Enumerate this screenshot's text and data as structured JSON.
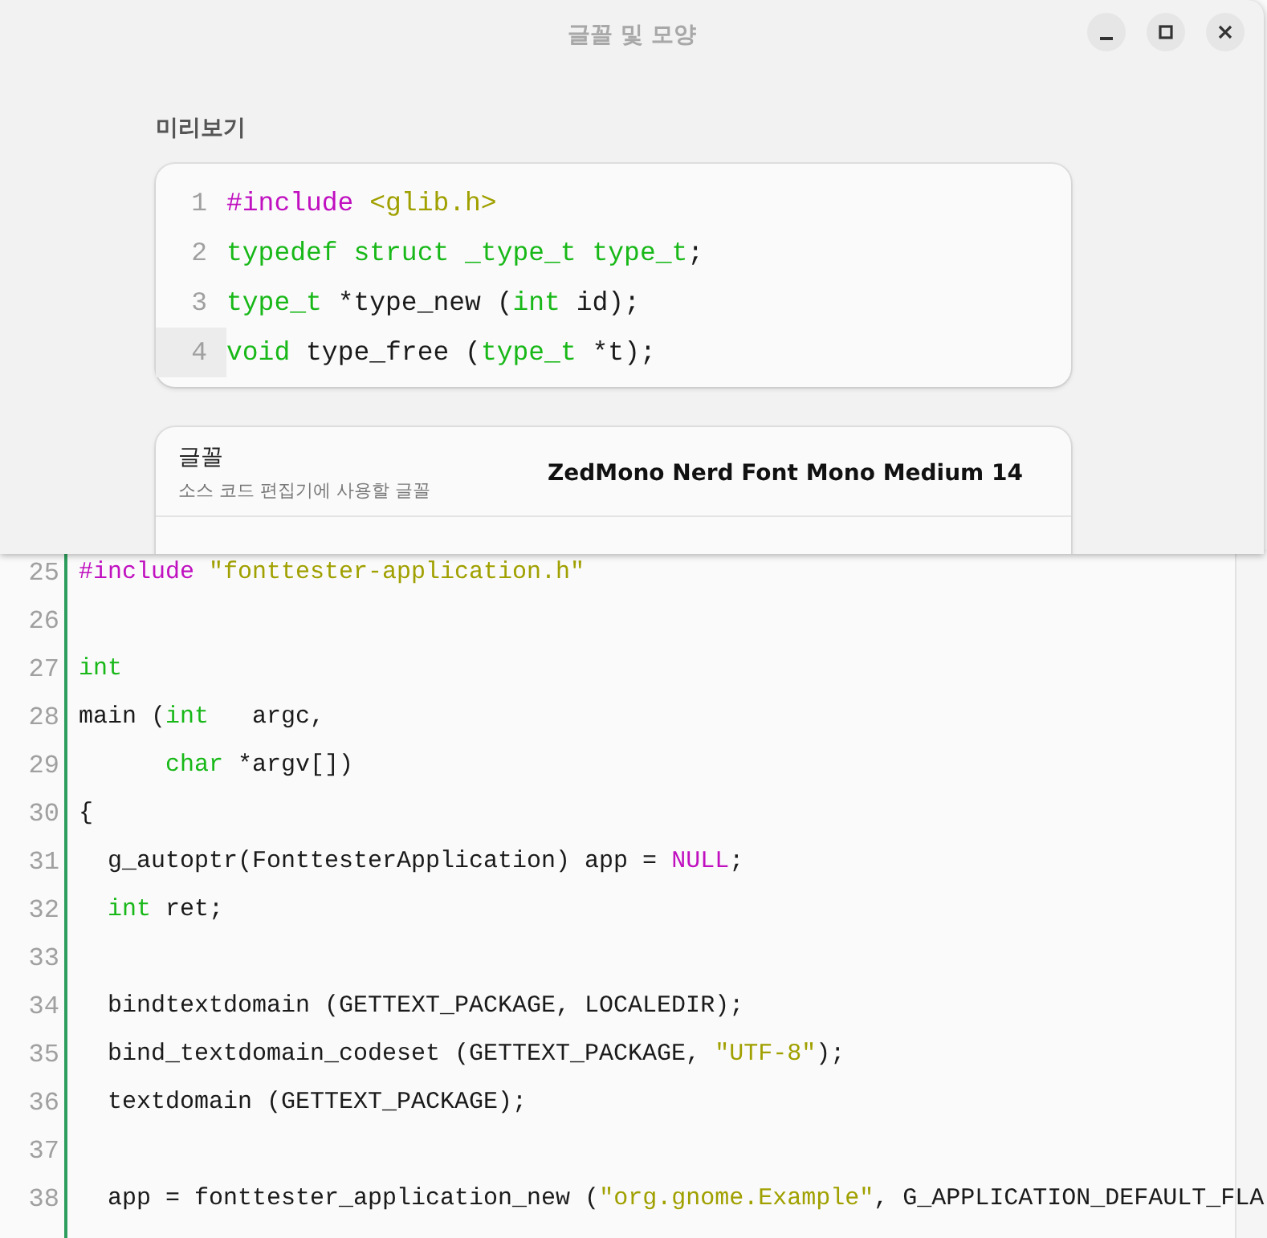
{
  "window": {
    "title": "글꼴 및 모양",
    "controls": [
      {
        "kind": "minimize"
      },
      {
        "kind": "maximize"
      },
      {
        "kind": "close"
      }
    ]
  },
  "preview": {
    "heading": "미리보기",
    "lines": [
      {
        "number": "1",
        "current": false,
        "tokens": [
          {
            "kind": "preproc",
            "text": "#include "
          },
          {
            "kind": "string",
            "text": "<glib.h>"
          }
        ]
      },
      {
        "number": "2",
        "current": false,
        "tokens": [
          {
            "kind": "type",
            "text": "typedef struct _type_t type_t"
          },
          {
            "kind": "plain",
            "text": ";"
          }
        ]
      },
      {
        "number": "3",
        "current": false,
        "tokens": [
          {
            "kind": "type",
            "text": "type_t"
          },
          {
            "kind": "plain",
            "text": " *type_new ("
          },
          {
            "kind": "type",
            "text": "int"
          },
          {
            "kind": "plain",
            "text": " id);"
          }
        ]
      },
      {
        "number": "4",
        "current": true,
        "tokens": [
          {
            "kind": "type",
            "text": "void"
          },
          {
            "kind": "plain",
            "text": " type_free ("
          },
          {
            "kind": "type",
            "text": "type_t"
          },
          {
            "kind": "plain",
            "text": " *t);"
          }
        ]
      }
    ]
  },
  "font_row": {
    "title": "글꼴",
    "subtitle": "소스 코드 편집기에 사용할 글꼴",
    "value": "ZedMono Nerd Font Mono Medium 14"
  },
  "editor": {
    "lines": [
      {
        "number": "25",
        "tokens": [
          {
            "kind": "preproc",
            "text": "#include "
          },
          {
            "kind": "string",
            "text": "\"fonttester-application.h\""
          }
        ]
      },
      {
        "number": "26"
      },
      {
        "number": "27",
        "tokens": [
          {
            "kind": "type",
            "text": "int"
          }
        ]
      },
      {
        "number": "28",
        "tokens": [
          {
            "kind": "plain",
            "text": "main ("
          },
          {
            "kind": "type",
            "text": "int"
          },
          {
            "kind": "plain",
            "text": "   argc,"
          }
        ]
      },
      {
        "number": "29",
        "tokens": [
          {
            "kind": "type",
            "text": "      char"
          },
          {
            "kind": "plain",
            "text": " *argv[])"
          }
        ]
      },
      {
        "number": "30",
        "tokens": [
          {
            "kind": "plain",
            "text": "{"
          }
        ]
      },
      {
        "number": "31",
        "tokens": [
          {
            "kind": "plain",
            "text": "  g_autoptr(FonttesterApplication) app = "
          },
          {
            "kind": "preproc",
            "text": "NULL"
          },
          {
            "kind": "plain",
            "text": ";"
          }
        ]
      },
      {
        "number": "32",
        "tokens": [
          {
            "kind": "type",
            "text": "  int"
          },
          {
            "kind": "plain",
            "text": " ret;"
          }
        ]
      },
      {
        "number": "33"
      },
      {
        "number": "34",
        "tokens": [
          {
            "kind": "plain",
            "text": "  bindtextdomain (GETTEXT_PACKAGE, LOCALEDIR);"
          }
        ]
      },
      {
        "number": "35",
        "tokens": [
          {
            "kind": "plain",
            "text": "  bind_textdomain_codeset (GETTEXT_PACKAGE, "
          },
          {
            "kind": "string",
            "text": "\"UTF-8\""
          },
          {
            "kind": "plain",
            "text": ");"
          }
        ]
      },
      {
        "number": "36",
        "tokens": [
          {
            "kind": "plain",
            "text": "  textdomain (GETTEXT_PACKAGE);"
          }
        ]
      },
      {
        "number": "37"
      },
      {
        "number": "38",
        "tokens": [
          {
            "kind": "plain",
            "text": "  app = fonttester_application_new ("
          },
          {
            "kind": "string",
            "text": "\"org.gnome.Example\""
          },
          {
            "kind": "plain",
            "text": ", G_APPLICATION_DEFAULT_FLA"
          }
        ]
      }
    ]
  }
}
